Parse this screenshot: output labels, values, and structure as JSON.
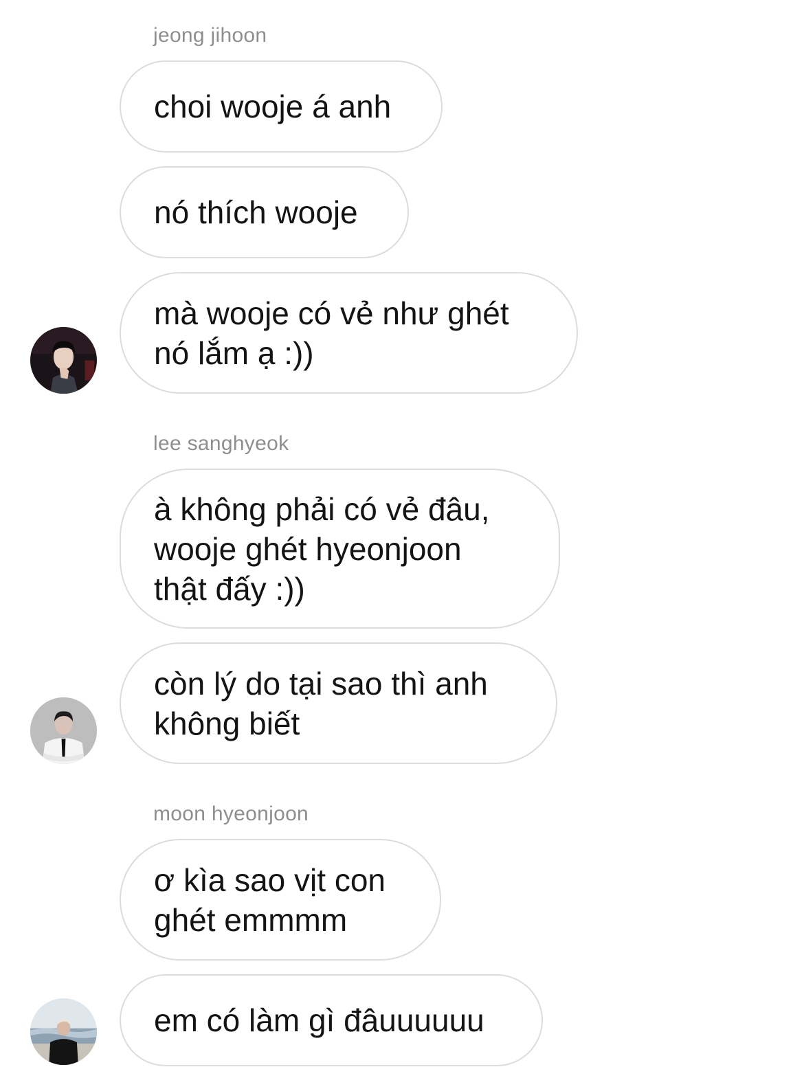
{
  "groups": [
    {
      "sender": "jeong jihoon",
      "avatar_icon": "profile-photo-dark-suit",
      "messages": [
        {
          "lines": [
            "choi wooje á anh"
          ]
        },
        {
          "lines": [
            "nó thích wooje"
          ]
        },
        {
          "lines": [
            "mà wooje có vẻ như ghét",
            "nó lắm ạ :))"
          ]
        }
      ]
    },
    {
      "sender": "lee sanghyeok",
      "avatar_icon": "profile-photo-white-shirt-tie",
      "messages": [
        {
          "lines": [
            "à không phải có vẻ đâu,",
            "wooje ghét hyeonjoon",
            "thật đấy :))"
          ]
        },
        {
          "lines": [
            "còn lý do tại sao thì anh",
            "không biết"
          ]
        }
      ]
    },
    {
      "sender": "moon hyeonjoon",
      "avatar_icon": "profile-photo-seaside",
      "messages": [
        {
          "lines": [
            "ơ kìa sao vịt con",
            "ghét emmmm"
          ]
        },
        {
          "lines": [
            "em có làm gì đâuuuuuu"
          ]
        }
      ]
    }
  ],
  "colors": {
    "bubble_border": "#dcdcdc",
    "sender_name": "#8e8e8e",
    "message_text": "#141414",
    "background": "#ffffff"
  }
}
